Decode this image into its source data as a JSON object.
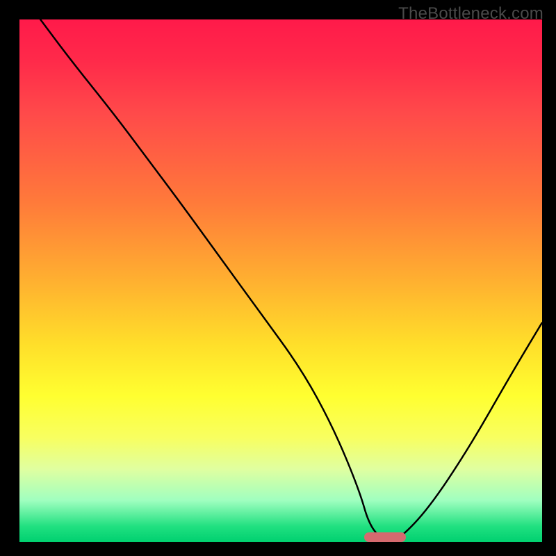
{
  "watermark": "TheBottleneck.com",
  "colors": {
    "curve": "#000000",
    "marker": "#d56a6f",
    "frame": "#000000"
  },
  "chart_data": {
    "type": "line",
    "title": "",
    "xlabel": "",
    "ylabel": "",
    "xlim": [
      0,
      100
    ],
    "ylim": [
      0,
      100
    ],
    "background_gradient": "red-yellow-green (top to bottom)",
    "series": [
      {
        "name": "bottleneck-curve",
        "x": [
          4,
          10,
          18,
          24,
          30,
          38,
          46,
          54,
          60,
          65,
          67,
          70,
          72,
          78,
          86,
          94,
          100
        ],
        "values": [
          100,
          92,
          82,
          74,
          66,
          55,
          44,
          33,
          22,
          10,
          3,
          0,
          0,
          6,
          18,
          32,
          42
        ]
      }
    ],
    "annotations": [
      {
        "name": "optimal-marker",
        "x_center": 70,
        "y": 0,
        "width_pct": 8
      }
    ],
    "grid": false,
    "legend": false
  }
}
